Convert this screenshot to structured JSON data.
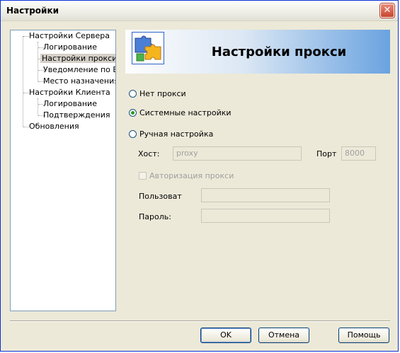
{
  "window": {
    "title": "Настройки"
  },
  "tree": {
    "items": [
      {
        "label": "Настройки Сервера"
      },
      {
        "label": "Логирование"
      },
      {
        "label": "Настройки прокси"
      },
      {
        "label": "Уведомление по E-ma"
      },
      {
        "label": "Место назначения"
      },
      {
        "label": "Настройки Клиента"
      },
      {
        "label": "Логирование"
      },
      {
        "label": "Подтверждения"
      },
      {
        "label": "Обновления"
      }
    ]
  },
  "banner": {
    "title": "Настройки прокси",
    "icon": "puzzle-icon"
  },
  "proxy": {
    "no_proxy": "Нет прокси",
    "system": "Системные настройки",
    "manual": "Ручная настройка",
    "selected": "system",
    "host_label": "Хост:",
    "host_value": "proxy",
    "port_label": "Порт",
    "port_value": "8000",
    "auth_label": "Авторизация прокси",
    "user_label": "Пользоват",
    "user_value": "",
    "password_label": "Пароль:",
    "password_value": ""
  },
  "buttons": {
    "ok": "OK",
    "cancel": "Отмена",
    "help": "Помощь"
  }
}
